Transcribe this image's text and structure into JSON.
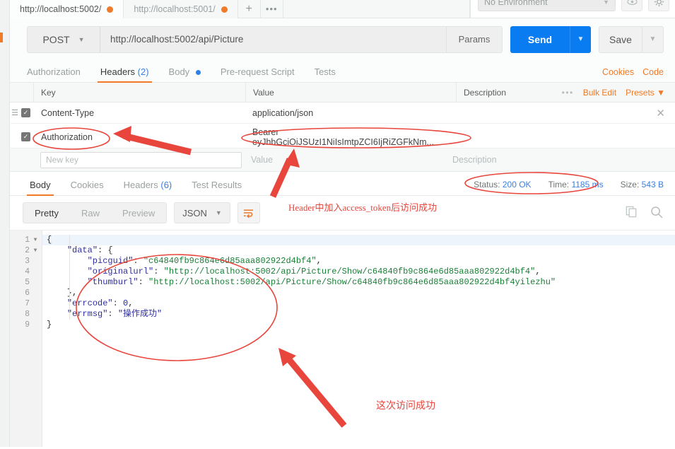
{
  "window": {
    "tabs": [
      {
        "label": "http://localhost:5002/",
        "state": "active",
        "dot": "unsaved-dot"
      },
      {
        "label": "http://localhost:5001/",
        "state": "inactive",
        "dot": "unsaved-dot"
      }
    ],
    "add_tab": "+",
    "more_tabs": "•••",
    "environment": {
      "selected": "No Environment"
    }
  },
  "request": {
    "method": "POST",
    "url": "http://localhost:5002/api/Picture",
    "params_label": "Params",
    "send_label": "Send",
    "save_label": "Save",
    "tabs": [
      {
        "label": "Authorization",
        "active": false
      },
      {
        "label": "Headers",
        "count": "(2)",
        "active": true
      },
      {
        "label": "Body",
        "active": false,
        "dot": true
      },
      {
        "label": "Pre-request Script",
        "active": false
      },
      {
        "label": "Tests",
        "active": false
      }
    ],
    "links": {
      "cookies": "Cookies",
      "code": "Code"
    }
  },
  "headers_table": {
    "columns": {
      "key": "Key",
      "value": "Value",
      "description": "Description"
    },
    "actions": {
      "dots": "•••",
      "bulk_edit": "Bulk Edit",
      "presets": "Presets"
    },
    "rows": [
      {
        "checked": true,
        "key": "Content-Type",
        "value": "application/json",
        "description": ""
      },
      {
        "checked": true,
        "key": "Authorization",
        "value": "Bearer eyJhbGciOiJSUzI1NiIsImtpZCI6IjRiZGFkNm...",
        "description": ""
      }
    ],
    "new_row": {
      "key_placeholder": "New key",
      "value_placeholder": "Value",
      "description_placeholder": "Description"
    }
  },
  "response": {
    "tabs": [
      {
        "label": "Body",
        "active": true
      },
      {
        "label": "Cookies",
        "active": false
      },
      {
        "label": "Headers",
        "count": "(6)",
        "active": false
      },
      {
        "label": "Test Results",
        "active": false
      }
    ],
    "meta": {
      "status_label": "Status:",
      "status_value": "200 OK",
      "time_label": "Time:",
      "time_value": "1185 ms",
      "size_label": "Size:",
      "size_value": "543 B"
    },
    "toolbar": {
      "views": [
        {
          "label": "Pretty",
          "active": true
        },
        {
          "label": "Raw",
          "active": false
        },
        {
          "label": "Preview",
          "active": false
        }
      ],
      "format": "JSON",
      "wrap_icon": "word-wrap-icon",
      "copy_icon": "copy-icon",
      "search_icon": "search-icon"
    },
    "body_lines": [
      {
        "n": "1",
        "fold": true,
        "segments": [
          {
            "t": "{",
            "c": "pun"
          }
        ]
      },
      {
        "n": "2",
        "fold": true,
        "segments": [
          {
            "t": "    ",
            "c": "pun"
          },
          {
            "t": "\"data\"",
            "c": "key"
          },
          {
            "t": ": {",
            "c": "pun"
          }
        ]
      },
      {
        "n": "3",
        "fold": false,
        "segments": [
          {
            "t": "        ",
            "c": "pun"
          },
          {
            "t": "\"picguid\"",
            "c": "key"
          },
          {
            "t": ": ",
            "c": "pun"
          },
          {
            "t": "\"c64840fb9c864e6d85aaa802922d4bf4\"",
            "c": "str"
          },
          {
            "t": ",",
            "c": "pun"
          }
        ]
      },
      {
        "n": "4",
        "fold": false,
        "segments": [
          {
            "t": "        ",
            "c": "pun"
          },
          {
            "t": "\"originalurl\"",
            "c": "key"
          },
          {
            "t": ": ",
            "c": "pun"
          },
          {
            "t": "\"http://localhost:5002/api/Picture/Show/c64840fb9c864e6d85aaa802922d4bf4\"",
            "c": "str"
          },
          {
            "t": ",",
            "c": "pun"
          }
        ]
      },
      {
        "n": "5",
        "fold": false,
        "segments": [
          {
            "t": "        ",
            "c": "pun"
          },
          {
            "t": "\"thumburl\"",
            "c": "key"
          },
          {
            "t": ": ",
            "c": "pun"
          },
          {
            "t": "\"http://localhost:5002/api/Picture/Show/c64840fb9c864e6d85aaa802922d4bf4yilezhu\"",
            "c": "str"
          }
        ]
      },
      {
        "n": "6",
        "fold": false,
        "segments": [
          {
            "t": "    },",
            "c": "pun"
          }
        ]
      },
      {
        "n": "7",
        "fold": false,
        "segments": [
          {
            "t": "    ",
            "c": "pun"
          },
          {
            "t": "\"errcode\"",
            "c": "key"
          },
          {
            "t": ": ",
            "c": "pun"
          },
          {
            "t": "0",
            "c": "num"
          },
          {
            "t": ",",
            "c": "pun"
          }
        ]
      },
      {
        "n": "8",
        "fold": false,
        "segments": [
          {
            "t": "    ",
            "c": "pun"
          },
          {
            "t": "\"errmsg\"",
            "c": "key"
          },
          {
            "t": ": ",
            "c": "pun"
          },
          {
            "t": "\"操作成功\"",
            "c": "zh"
          }
        ]
      },
      {
        "n": "9",
        "fold": false,
        "segments": [
          {
            "t": "}",
            "c": "pun"
          }
        ]
      }
    ]
  },
  "annotations": {
    "color": "#e8453c",
    "note_top": "Header中加入access_token后访问成功",
    "note_bottom": "这次访问成功"
  }
}
